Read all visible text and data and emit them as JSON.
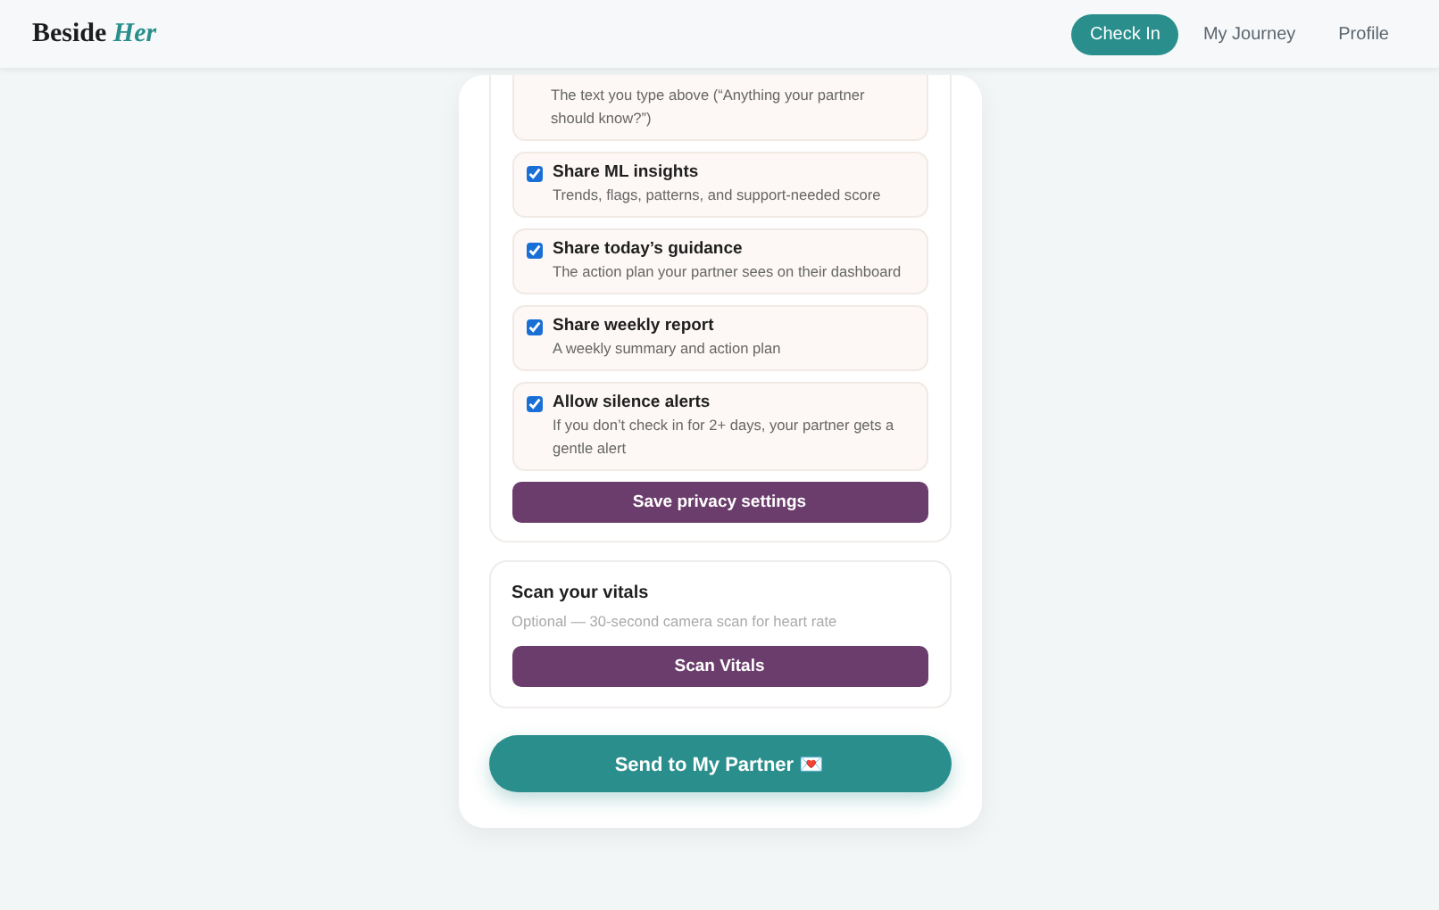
{
  "header": {
    "logo": {
      "plain": "Beside",
      "accent": "Her"
    },
    "nav": [
      {
        "label": "Check In",
        "selected": true
      },
      {
        "label": "My Journey",
        "selected": false
      },
      {
        "label": "Profile",
        "selected": false
      }
    ]
  },
  "privacy": {
    "options": [
      {
        "kind": "partial",
        "description": "The text you type above (“Anything your partner should know?”)"
      },
      {
        "kind": "checkbox",
        "title": "Share ML insights",
        "description": "Trends, flags, patterns, and support-needed score",
        "checked": true
      },
      {
        "kind": "checkbox",
        "title": "Share today’s guidance",
        "description": "The action plan your partner sees on their dashboard",
        "checked": true
      },
      {
        "kind": "checkbox",
        "title": "Share weekly report",
        "description": "A weekly summary and action plan",
        "checked": true
      },
      {
        "kind": "checkbox",
        "title": "Allow silence alerts",
        "description": "If you don’t check in for 2+ days, your partner gets a gentle alert",
        "checked": true
      }
    ],
    "save_button": "Save privacy settings"
  },
  "vitals": {
    "title": "Scan your vitals",
    "subtitle": "Optional — 30-second camera scan for heart rate",
    "button": "Scan Vitals"
  },
  "send_button": "Send to My Partner 💌"
}
